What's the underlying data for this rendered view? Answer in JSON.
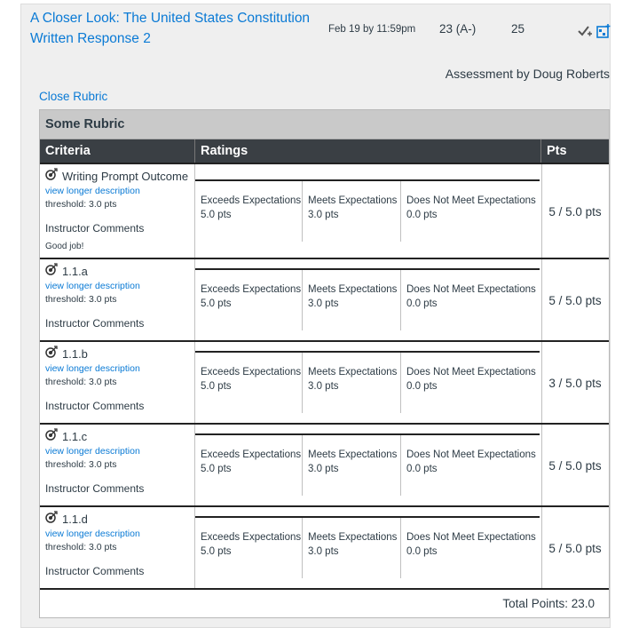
{
  "assignment": {
    "title": "A Closer Look: The United States Constitution Written Response 2",
    "due": "Feb 19 by 11:59pm",
    "score": "23 (A-)",
    "possible": "25",
    "icons": [
      "checkmark-plus-icon",
      "add-calendar-icon"
    ]
  },
  "assessment_by": "Assessment by Doug Roberts",
  "close_rubric": "Close Rubric",
  "rubric": {
    "name": "Some Rubric",
    "headers": {
      "criteria": "Criteria",
      "ratings": "Ratings",
      "pts": "Pts"
    },
    "rows": [
      {
        "title": "Writing Prompt Outcome",
        "long_desc": "view longer description",
        "threshold": "threshold: 3.0 pts",
        "instructor_label": "Instructor Comments",
        "comment": "Good job!",
        "ratings": [
          {
            "label": "Exceeds Expectations",
            "pts": "5.0 pts"
          },
          {
            "label": "Meets Expectations",
            "pts": "3.0 pts"
          },
          {
            "label": "Does Not Meet Expectations",
            "pts": "0.0 pts"
          }
        ],
        "score": "5 / 5.0 pts"
      },
      {
        "title": "1.1.a",
        "long_desc": "view longer description",
        "threshold": "threshold: 3.0 pts",
        "instructor_label": "Instructor Comments",
        "ratings": [
          {
            "label": "Exceeds Expectations",
            "pts": "5.0 pts"
          },
          {
            "label": "Meets Expectations",
            "pts": "3.0 pts"
          },
          {
            "label": "Does Not Meet Expectations",
            "pts": "0.0 pts"
          }
        ],
        "score": "5 / 5.0 pts"
      },
      {
        "title": "1.1.b",
        "long_desc": "view longer description",
        "threshold": "threshold: 3.0 pts",
        "instructor_label": "Instructor Comments",
        "ratings": [
          {
            "label": "Exceeds Expectations",
            "pts": "5.0 pts"
          },
          {
            "label": "Meets Expectations",
            "pts": "3.0 pts"
          },
          {
            "label": "Does Not Meet Expectations",
            "pts": "0.0 pts"
          }
        ],
        "score": "3 / 5.0 pts"
      },
      {
        "title": "1.1.c",
        "long_desc": "view longer description",
        "threshold": "threshold: 3.0 pts",
        "instructor_label": "Instructor Comments",
        "ratings": [
          {
            "label": "Exceeds Expectations",
            "pts": "5.0 pts"
          },
          {
            "label": "Meets Expectations",
            "pts": "3.0 pts"
          },
          {
            "label": "Does Not Meet Expectations",
            "pts": "0.0 pts"
          }
        ],
        "score": "5 / 5.0 pts"
      },
      {
        "title": "1.1.d",
        "long_desc": "view longer description",
        "threshold": "threshold: 3.0 pts",
        "instructor_label": "Instructor Comments",
        "ratings": [
          {
            "label": "Exceeds Expectations",
            "pts": "5.0 pts"
          },
          {
            "label": "Meets Expectations",
            "pts": "3.0 pts"
          },
          {
            "label": "Does Not Meet Expectations",
            "pts": "0.0 pts"
          }
        ],
        "score": "5 / 5.0 pts"
      }
    ],
    "total": "Total Points: 23.0"
  },
  "colors": {
    "link": "#0a7ad5",
    "header_dark": "#3a3f44",
    "rubric_title_bg": "#c9c9c9"
  }
}
